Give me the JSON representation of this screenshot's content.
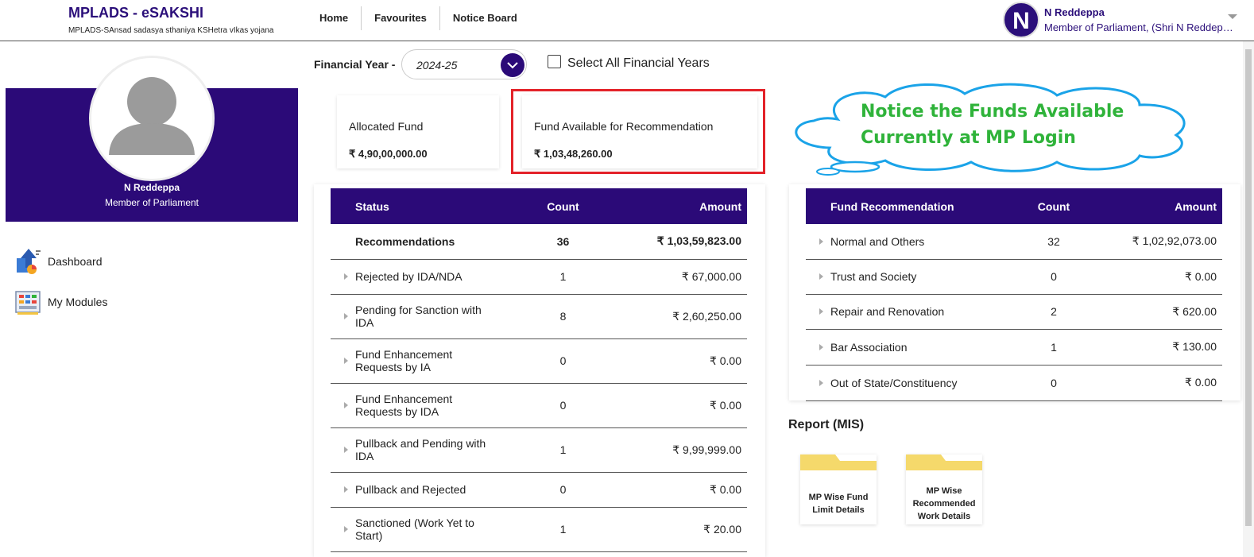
{
  "header": {
    "brand_title": "MPLADS - eSAKSHI",
    "brand_subtitle": "MPLADS-SAnsad sadasya sthaniya KSHetra vIkas yojana",
    "nav": [
      "Home",
      "Favourites",
      "Notice Board"
    ],
    "user": {
      "initial": "N",
      "name": "N Reddeppa",
      "role": "Member of Parliament,  (Shri N Reddeppa)"
    }
  },
  "profile": {
    "name": "N Reddeppa",
    "role": "Member of Parliament"
  },
  "sidebar": {
    "items": [
      {
        "label": "Dashboard",
        "icon": "dashboard-icon"
      },
      {
        "label": "My Modules",
        "icon": "modules-icon"
      }
    ]
  },
  "filters": {
    "financial_year_label": "Financial Year -",
    "financial_year_value": "2024-25",
    "select_all_label": "Select All Financial Years",
    "select_all_checked": false
  },
  "funds": {
    "allocated": {
      "title": "Allocated Fund",
      "value": "₹ 4,90,00,000.00"
    },
    "available": {
      "title": "Fund Available for Recommendation",
      "value": "₹ 1,03,48,260.00"
    }
  },
  "annotation": {
    "line1": "Notice the Funds Available",
    "line2": "Currently at MP Login"
  },
  "status_table": {
    "headers": [
      "Status",
      "Count",
      "Amount"
    ],
    "rows": [
      {
        "name": "Recommendations",
        "count": "36",
        "amount": "₹ 1,03,59,823.00",
        "bold": true
      },
      {
        "name": "Rejected by IDA/NDA",
        "count": "1",
        "amount": "₹ 67,000.00"
      },
      {
        "name": "Pending for Sanction with IDA",
        "count": "8",
        "amount": "₹ 2,60,250.00"
      },
      {
        "name": "Fund Enhancement Requests by IA",
        "count": "0",
        "amount": "₹ 0.00"
      },
      {
        "name": "Fund Enhancement Requests by IDA",
        "count": "0",
        "amount": "₹ 0.00"
      },
      {
        "name": "Pullback and Pending with IDA",
        "count": "1",
        "amount": "₹ 9,99,999.00"
      },
      {
        "name": "Pullback and Rejected",
        "count": "0",
        "amount": "₹ 0.00"
      },
      {
        "name": "Sanctioned (Work Yet to Start)",
        "count": "1",
        "amount": "₹ 20.00"
      }
    ]
  },
  "recommendation_table": {
    "headers": [
      "Fund Recommendation",
      "Count",
      "Amount"
    ],
    "rows": [
      {
        "name": "Normal and Others",
        "count": "32",
        "amount": "₹ 1,02,92,073.00"
      },
      {
        "name": "Trust and Society",
        "count": "0",
        "amount": "₹ 0.00"
      },
      {
        "name": "Repair and Renovation",
        "count": "2",
        "amount": "₹ 620.00"
      },
      {
        "name": "Bar Association",
        "count": "1",
        "amount": "₹ 130.00"
      },
      {
        "name": "Out of State/Constituency",
        "count": "0",
        "amount": "₹ 0.00"
      }
    ]
  },
  "reports": {
    "title": "Report (MIS)",
    "items": [
      "MP Wise Fund Limit Details",
      "MP Wise Recommended Work Details"
    ]
  },
  "colors": {
    "primary": "#2b0a78",
    "highlight_border": "#e32229",
    "annotation_text": "#2fb33a",
    "annotation_cloud": "#1aa3e8",
    "folder": "#f5d96b"
  }
}
